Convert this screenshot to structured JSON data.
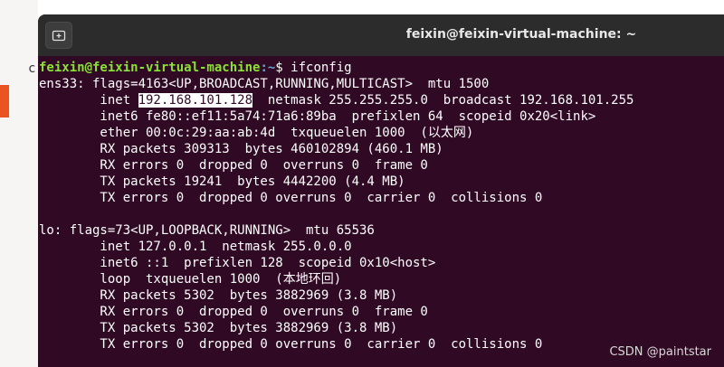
{
  "window": {
    "title": "feixin@feixin-virtual-machine: ~",
    "background": "#300a24"
  },
  "background": {
    "stub_char": "c"
  },
  "terminal": {
    "prompt_user": "feixin@feixin-virtual-machine",
    "prompt_path": ":~",
    "prompt_symbol": "$ ",
    "command": "ifconfig",
    "ens33": {
      "flags": "ens33: flags=4163<UP,BROADCAST,RUNNING,MULTICAST>  mtu 1500",
      "inet_label": "        inet ",
      "inet_addr": "192.168.101.128",
      "inet_rest": "  netmask 255.255.255.0  broadcast 192.168.101.255",
      "inet6": "        inet6 fe80::ef11:5a74:71a6:89ba  prefixlen 64  scopeid 0x20<link>",
      "ether": "        ether 00:0c:29:aa:ab:4d  txqueuelen 1000  (以太网)",
      "rx_packets": "        RX packets 309313  bytes 460102894 (460.1 MB)",
      "rx_errors": "        RX errors 0  dropped 0  overruns 0  frame 0",
      "tx_packets": "        TX packets 19241  bytes 4442200 (4.4 MB)",
      "tx_errors": "        TX errors 0  dropped 0 overruns 0  carrier 0  collisions 0"
    },
    "lo": {
      "flags": "lo: flags=73<UP,LOOPBACK,RUNNING>  mtu 65536",
      "inet": "        inet 127.0.0.1  netmask 255.0.0.0",
      "inet6": "        inet6 ::1  prefixlen 128  scopeid 0x10<host>",
      "loop": "        loop  txqueuelen 1000  (本地环回)",
      "rx_packets": "        RX packets 5302  bytes 3882969 (3.8 MB)",
      "rx_errors": "        RX errors 0  dropped 0  overruns 0  frame 0",
      "tx_packets": "        TX packets 5302  bytes 3882969 (3.8 MB)",
      "tx_errors": "        TX errors 0  dropped 0 overruns 0  carrier 0  collisions 0"
    }
  },
  "watermark": "CSDN @paintstar",
  "icons": {
    "new_tab": "new-tab-icon"
  },
  "colors": {
    "prompt_user": "#8ae234",
    "prompt_path": "#729fcf",
    "titlebar": "#2c2c2c",
    "accent": "#e95420"
  }
}
